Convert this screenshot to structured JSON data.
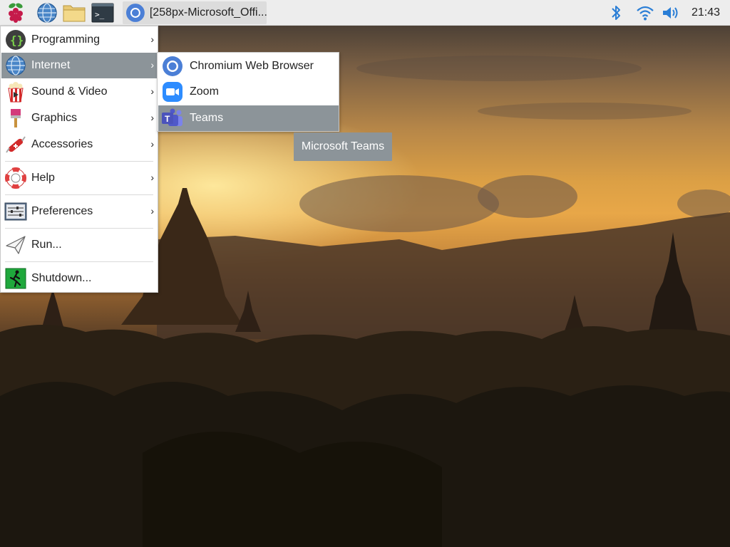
{
  "taskbar": {
    "launchers": [
      {
        "icon": "raspberry-menu-icon"
      },
      {
        "icon": "web-browser-icon"
      },
      {
        "icon": "file-manager-icon"
      },
      {
        "icon": "terminal-icon"
      }
    ],
    "active_task": {
      "icon": "chromium-icon",
      "label": "[258px-Microsoft_Offi..."
    },
    "tray": {
      "bluetooth_icon": "bluetooth-icon",
      "wifi_icon": "wifi-icon",
      "volume_icon": "volume-icon",
      "clock": "21:43"
    }
  },
  "menu": {
    "items": [
      {
        "label": "Programming",
        "icon": "programming-icon",
        "submenu": true
      },
      {
        "label": "Internet",
        "icon": "internet-globe-icon",
        "submenu": true,
        "active": true
      },
      {
        "label": "Sound & Video",
        "icon": "sound-video-icon",
        "submenu": true
      },
      {
        "label": "Graphics",
        "icon": "graphics-icon",
        "submenu": true
      },
      {
        "label": "Accessories",
        "icon": "accessories-icon",
        "submenu": true
      },
      {
        "label": "Help",
        "icon": "help-lifebuoy-icon",
        "submenu": true
      },
      {
        "label": "Preferences",
        "icon": "preferences-icon",
        "submenu": true
      },
      {
        "label": "Run...",
        "icon": "run-paper-plane-icon",
        "submenu": false
      },
      {
        "label": "Shutdown...",
        "icon": "shutdown-exit-icon",
        "submenu": false
      }
    ],
    "arrow": "›"
  },
  "submenu": {
    "items": [
      {
        "label": "Chromium Web Browser",
        "icon": "chromium-icon"
      },
      {
        "label": "Zoom",
        "icon": "zoom-icon"
      },
      {
        "label": "Teams",
        "icon": "teams-icon",
        "active": true
      }
    ]
  },
  "tooltip": {
    "text": "Microsoft Teams"
  },
  "colors": {
    "highlight": "#8c9499",
    "taskbar": "#ededed"
  }
}
